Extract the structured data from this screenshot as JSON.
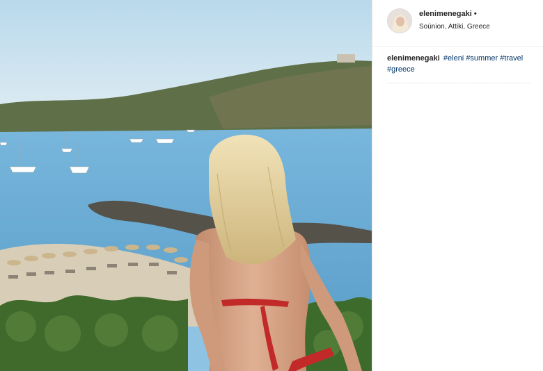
{
  "post": {
    "username": "elenimenegaki",
    "follow_dot": "•",
    "location": "Soúnion, Attiki, Greece",
    "caption": {
      "username": "elenimenegaki",
      "hashtags": [
        "#eleni",
        "#summer",
        "#travel",
        "#greece"
      ]
    }
  },
  "photo": {
    "description_icon": "beach-photo",
    "colors": {
      "sky": "#cfe3ee",
      "sea": "#6fb0d8",
      "hill": "#5b6a43",
      "sand": "#d8cdb6",
      "hair": "#e8d7a6",
      "skin": "#d6a487",
      "bikini": "#c22a2a",
      "foliage": "#3f6a2c"
    }
  }
}
